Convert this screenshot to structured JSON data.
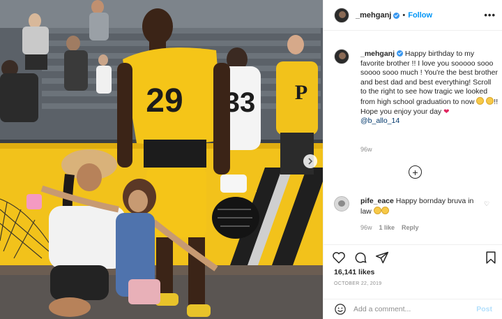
{
  "post": {
    "photo_description_icon": "photo",
    "carousel_next_icon": "chevron-right-icon"
  },
  "header": {
    "username": "_mehganj",
    "separator": "•",
    "follow_label": "Follow",
    "more_label": "•••"
  },
  "caption": {
    "username": "_mehganj",
    "text": " Happy birthday to my favorite brother !! I love you sooooo sooo soooo sooo much ! You're the best brother and best dad and best everything! Scroll to the right to see how tragic we looked from high school graduation to now ",
    "text_after_emoji": "!! Hope you enjoy your day ",
    "mention": "@b_allo_14",
    "time": "96w"
  },
  "comment": {
    "username": "pife_eace",
    "text": " Happy bornday bruva in law",
    "time": "96w",
    "likes": "1 like",
    "reply": "Reply"
  },
  "stats": {
    "likes": "16,141 likes",
    "date": "OCTOBER 22, 2019"
  },
  "add_comment": {
    "placeholder": "Add a comment...",
    "post_label": "Post"
  },
  "jersey": {
    "front_number": "29",
    "back_number": "33"
  },
  "colors": {
    "steelers_gold": "#f5c518",
    "accent_blue": "#0095f6",
    "verified_blue": "#3897f0"
  }
}
